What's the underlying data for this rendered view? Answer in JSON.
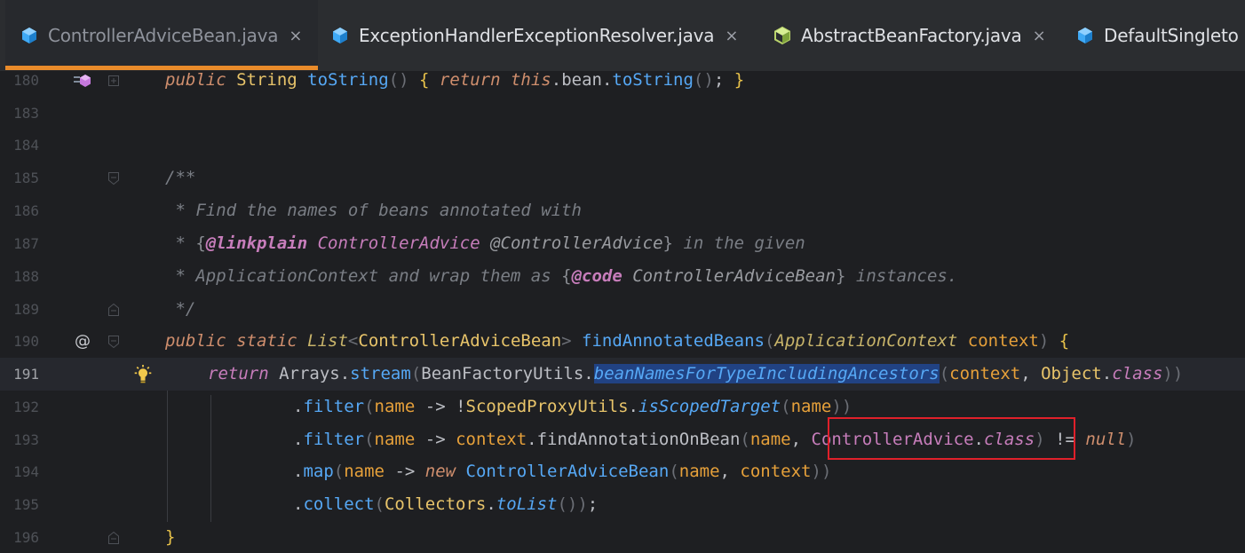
{
  "tabs": [
    {
      "name": "ControllerAdviceBean.java",
      "close": "×",
      "icon": "java-class-icon",
      "active": true
    },
    {
      "name": "ExceptionHandlerExceptionResolver.java",
      "close": "×",
      "icon": "java-class-icon",
      "active": false
    },
    {
      "name": "AbstractBeanFactory.java",
      "close": "×",
      "icon": "abstract-class-icon",
      "active": false
    },
    {
      "name": "DefaultSingleto",
      "close": "",
      "icon": "java-class-icon",
      "active": false
    }
  ],
  "lines": [
    {
      "num": "180"
    },
    {
      "num": "183"
    },
    {
      "num": "184"
    },
    {
      "num": "185"
    },
    {
      "num": "186"
    },
    {
      "num": "187"
    },
    {
      "num": "188"
    },
    {
      "num": "189"
    },
    {
      "num": "190"
    },
    {
      "num": "191"
    },
    {
      "num": "192"
    },
    {
      "num": "193"
    },
    {
      "num": "194"
    },
    {
      "num": "195"
    },
    {
      "num": "196"
    }
  ],
  "code": {
    "l180": {
      "kw1": "public",
      "type": " String ",
      "fn": "toString",
      "p1": "()",
      "b1": " { ",
      "kw2": "return",
      "kw3": " this",
      "dot": ".",
      "field": "bean",
      "dot2": ".",
      "fn2": "toString",
      "p2": "()",
      "semi": "; ",
      "b2": "}"
    },
    "l185": "/**",
    "l186": " * Find the names of beans annotated with",
    "l187": {
      "a": " * ",
      "b": "{",
      "tag": "@linkplain",
      "cls": " ControllerAdvice",
      "ref": " @ControllerAdvice",
      "c": "}",
      "d": " in the given"
    },
    "l188": {
      "a": " * ApplicationContext and wrap them as ",
      "b": "{",
      "tag": "@code",
      "ref": " ControllerAdviceBean",
      "c": "}",
      "d": " instances."
    },
    "l189": " */",
    "l190": {
      "kw1": "public",
      "kw2": " static",
      "type": " List",
      "lt": "<",
      "type2": "ControllerAdviceBean",
      "gt": ">",
      "fn": " findAnnotatedBeans",
      "p": "(",
      "ptype": "ApplicationContext",
      "pname": " context",
      "p2": ")",
      "b": " {"
    },
    "l191": {
      "kw": "return",
      "t1": " Arrays",
      "d1": ".",
      "fn1": "stream",
      "p1": "(",
      "t2": "BeanFactoryUtils",
      "d2": ".",
      "fn2": "beanNamesForTypeIncludingAncestors",
      "p2": "(",
      "a1": "context",
      "c1": ", ",
      "t3": "Object",
      "d3": ".",
      "cls": "class",
      "p3": "))"
    },
    "l192": {
      "d": ".",
      "fn": "filter",
      "p": "(",
      "a": "name",
      "op": " -> !",
      "t": "ScopedProxyUtils",
      "d2": ".",
      "fn2": "isScopedTarget",
      "p2": "(",
      "a2": "name",
      "p3": "))"
    },
    "l193": {
      "d": ".",
      "fn": "filter",
      "p": "(",
      "a": "name",
      "op": " -> ",
      "a2": "context",
      "d2": ".",
      "fn2": "findAnnotationOnBean",
      "p2": "(",
      "a3": "name",
      "c": ", ",
      "t": "ControllerAdvice",
      "d3": ".",
      "cls": "class",
      "p3": ")",
      "op2": " != ",
      "kw": "null",
      "p4": ")"
    },
    "l194": {
      "d": ".",
      "fn": "map",
      "p": "(",
      "a": "name",
      "op": " -> ",
      "kw": "new",
      "t": " ControllerAdviceBean",
      "p2": "(",
      "a2": "name",
      "c": ", ",
      "a3": "context",
      "p3": "))"
    },
    "l195": {
      "d": ".",
      "fn": "collect",
      "p": "(",
      "t": "Collectors",
      "d2": ".",
      "fn2": "toList",
      "p2": "())",
      "semi": ";"
    },
    "l196": "}"
  },
  "gutter": {
    "at_marker": "@",
    "colors": {
      "accent_tab": "#e98b2a",
      "highlight_box": "#e0202a"
    }
  }
}
